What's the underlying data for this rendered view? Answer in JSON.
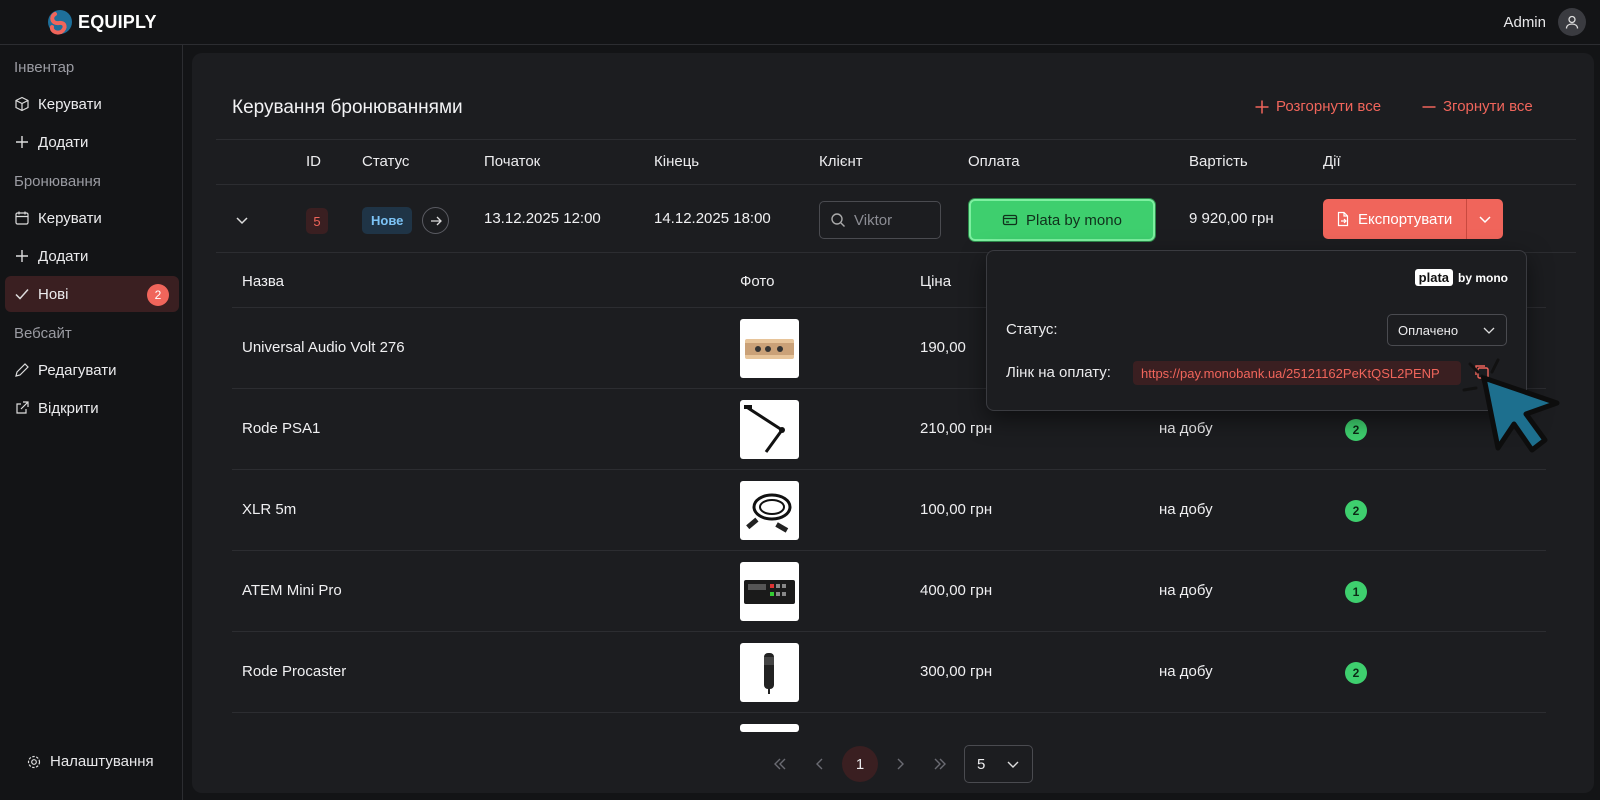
{
  "app": {
    "name": "EQUIPLY",
    "user": "Admin"
  },
  "sidebar": {
    "sections": [
      {
        "title": "Інвентар"
      },
      {
        "title": "Бронювання"
      },
      {
        "title": "Вебсайт"
      }
    ],
    "items": [
      {
        "label": "Керувати"
      },
      {
        "label": "Додати"
      },
      {
        "label": "Керувати"
      },
      {
        "label": "Додати"
      },
      {
        "label": "Нові",
        "badge": "2"
      },
      {
        "label": "Редагувати"
      },
      {
        "label": "Відкрити"
      }
    ],
    "settings": "Налаштування"
  },
  "page": {
    "title": "Керування бронюваннями",
    "expand_all": "Розгорнути все",
    "collapse_all": "Згорнути все"
  },
  "table": {
    "headers": [
      "ID",
      "Статус",
      "Початок",
      "Кінець",
      "Клієнт",
      "Оплата",
      "Вартість",
      "Дії"
    ],
    "row": {
      "id": "5",
      "status": "Нове",
      "start": "13.12.2025  12:00",
      "end": "14.12.2025  18:00",
      "client_placeholder": "Viktor",
      "payment": "Plata by mono",
      "cost": "9 920,00 грн",
      "action": "Експортувати"
    }
  },
  "items": {
    "headers": [
      "Назва",
      "Фото",
      "Ціна"
    ],
    "rows": [
      {
        "name": "Universal Audio Volt 276",
        "price": "190,00",
        "period": "",
        "qty": ""
      },
      {
        "name": "Rode PSA1",
        "price": "210,00 грн",
        "period": "на добу",
        "qty": "2"
      },
      {
        "name": "XLR 5m",
        "price": "100,00 грн",
        "period": "на добу",
        "qty": "2"
      },
      {
        "name": "ATEM Mini Pro",
        "price": "400,00 грн",
        "period": "на добу",
        "qty": "1"
      },
      {
        "name": "Rode Procaster",
        "price": "300,00 грн",
        "period": "на добу",
        "qty": "2"
      }
    ]
  },
  "popover": {
    "brand_left": "plata",
    "brand_right": "by mono",
    "status_label": "Статус:",
    "status_value": "Оплачено",
    "link_label": "Лінк на оплату:",
    "link_value": "https://pay.monobank.ua/25121162PeKtQSL2PENP"
  },
  "pagination": {
    "current": "1",
    "page_size": "5"
  },
  "colors": {
    "accent": "#f0655b",
    "green": "#3ecf6e",
    "bg": "#131416",
    "panel": "#1c1d20"
  }
}
